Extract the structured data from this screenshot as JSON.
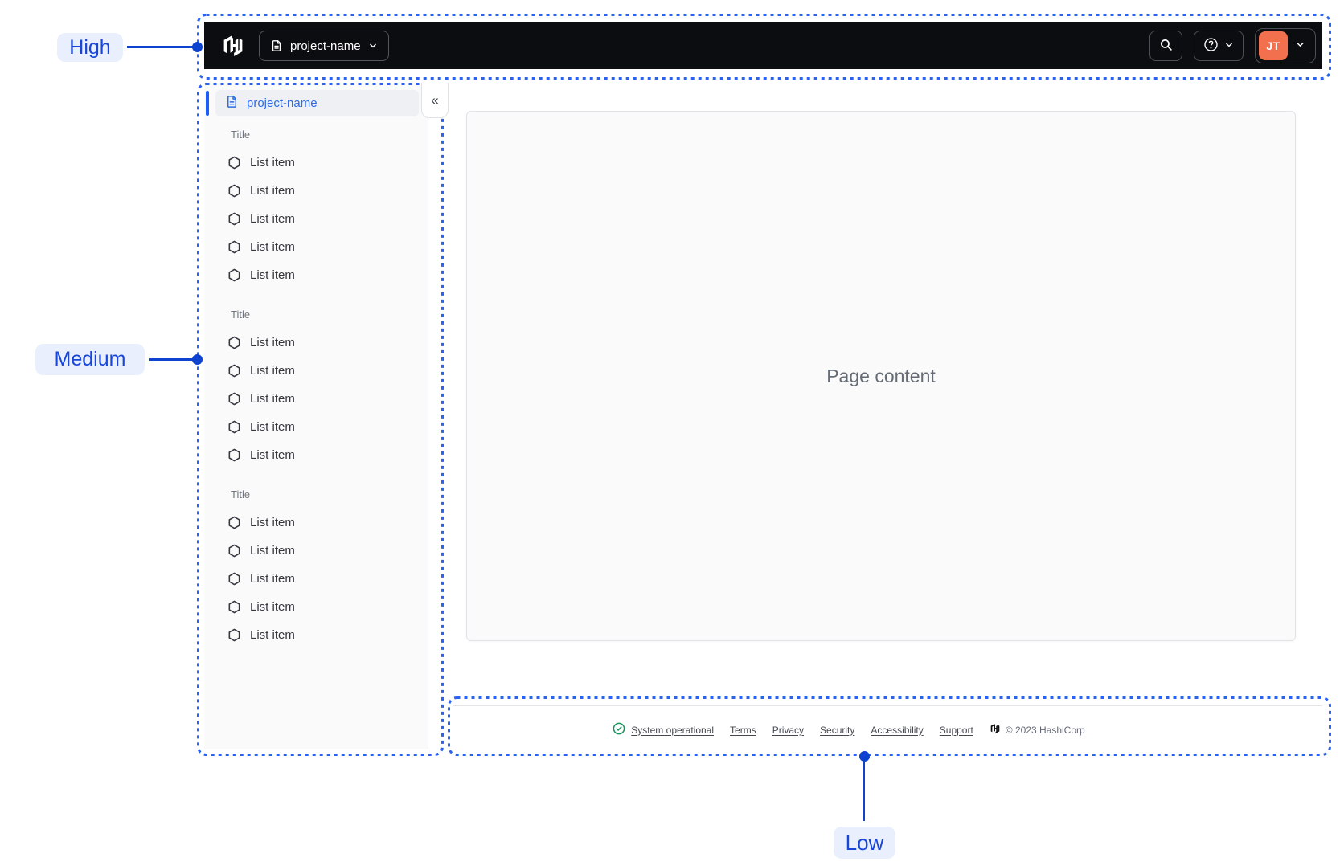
{
  "annotations": {
    "high": {
      "label": "High"
    },
    "medium": {
      "label": "Medium"
    },
    "low": {
      "label": "Low"
    }
  },
  "navbar": {
    "project_switcher": {
      "label": "project-name"
    },
    "user_menu": {
      "initials": "JT"
    }
  },
  "sidebar": {
    "project_link": {
      "label": "project-name"
    },
    "collapse_glyph": "«",
    "sections": [
      {
        "title": "Title",
        "items": [
          "List item",
          "List item",
          "List item",
          "List item",
          "List item"
        ]
      },
      {
        "title": "Title",
        "items": [
          "List item",
          "List item",
          "List item",
          "List item",
          "List item"
        ]
      },
      {
        "title": "Title",
        "items": [
          "List item",
          "List item",
          "List item",
          "List item",
          "List item"
        ]
      }
    ]
  },
  "main": {
    "placeholder": "Page content"
  },
  "footer": {
    "status": {
      "label": "System operational"
    },
    "links": [
      "Terms",
      "Privacy",
      "Security",
      "Accessibility",
      "Support"
    ],
    "copyright": "© 2023 HashiCorp"
  },
  "colors": {
    "navbar_bg": "#0c0d10",
    "avatar_orange": "#f3704e",
    "sidebar_active_blue": "#2e6be4",
    "sidebar_active_bar": "#1a5eff",
    "status_green": "#18915a",
    "zone_border_blue": "#2a62f2",
    "connector_blue": "#0d43cf",
    "chip_text_blue": "#1847d8",
    "chip_bg": "#e9effc",
    "content_bg": "#fafafa"
  }
}
